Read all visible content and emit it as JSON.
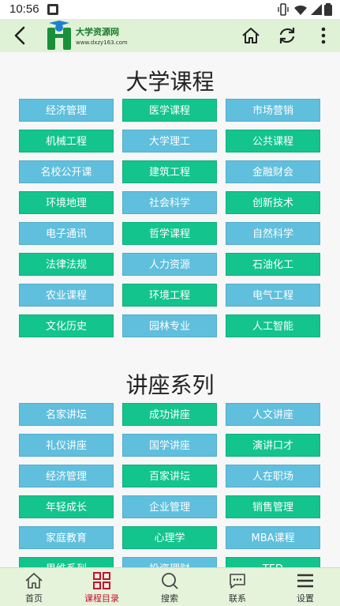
{
  "status_bar": {
    "time": "10:56"
  },
  "app_bar": {
    "logo_name": "大学资源网",
    "logo_url": "www.dxzy163.com"
  },
  "colors": {
    "blue": "#5fbfdd",
    "green": "#13c48d",
    "header_bg": "#dff2d6",
    "active_tab": "#c8102e"
  },
  "sections": [
    {
      "title": "大学课程",
      "items": [
        {
          "label": "经济管理",
          "color": "blue"
        },
        {
          "label": "医学课程",
          "color": "green"
        },
        {
          "label": "市场营销",
          "color": "blue"
        },
        {
          "label": "机械工程",
          "color": "green"
        },
        {
          "label": "大学理工",
          "color": "blue"
        },
        {
          "label": "公共课程",
          "color": "green"
        },
        {
          "label": "名校公开课",
          "color": "blue"
        },
        {
          "label": "建筑工程",
          "color": "green"
        },
        {
          "label": "金融财会",
          "color": "blue"
        },
        {
          "label": "环境地理",
          "color": "green"
        },
        {
          "label": "社会科学",
          "color": "blue"
        },
        {
          "label": "创新技术",
          "color": "green"
        },
        {
          "label": "电子通讯",
          "color": "blue"
        },
        {
          "label": "哲学课程",
          "color": "green"
        },
        {
          "label": "自然科学",
          "color": "blue"
        },
        {
          "label": "法律法规",
          "color": "green"
        },
        {
          "label": "人力资源",
          "color": "blue"
        },
        {
          "label": "石油化工",
          "color": "green"
        },
        {
          "label": "农业课程",
          "color": "blue"
        },
        {
          "label": "环境工程",
          "color": "green"
        },
        {
          "label": "电气工程",
          "color": "blue"
        },
        {
          "label": "文化历史",
          "color": "green"
        },
        {
          "label": "园林专业",
          "color": "blue"
        },
        {
          "label": "人工智能",
          "color": "green"
        }
      ]
    },
    {
      "title": "讲座系列",
      "items": [
        {
          "label": "名家讲坛",
          "color": "blue"
        },
        {
          "label": "成功讲座",
          "color": "green"
        },
        {
          "label": "人文讲座",
          "color": "blue"
        },
        {
          "label": "礼仪讲座",
          "color": "blue"
        },
        {
          "label": "国学讲座",
          "color": "blue"
        },
        {
          "label": "演讲口才",
          "color": "green"
        },
        {
          "label": "经济管理",
          "color": "blue"
        },
        {
          "label": "百家讲坛",
          "color": "green"
        },
        {
          "label": "人在职场",
          "color": "blue"
        },
        {
          "label": "年轻成长",
          "color": "green"
        },
        {
          "label": "企业管理",
          "color": "blue"
        },
        {
          "label": "销售管理",
          "color": "green"
        },
        {
          "label": "家庭教育",
          "color": "blue"
        },
        {
          "label": "心理学",
          "color": "green"
        },
        {
          "label": "MBA课程",
          "color": "blue"
        },
        {
          "label": "思维系列",
          "color": "green"
        },
        {
          "label": "投资理财",
          "color": "blue"
        },
        {
          "label": "TED",
          "color": "green"
        }
      ]
    }
  ],
  "tabs": [
    {
      "label": "首页",
      "icon": "home-icon",
      "active": false
    },
    {
      "label": "课程目录",
      "icon": "grid-icon",
      "active": true
    },
    {
      "label": "搜索",
      "icon": "search-icon",
      "active": false
    },
    {
      "label": "联系",
      "icon": "chat-icon",
      "active": false
    },
    {
      "label": "设置",
      "icon": "menu-icon",
      "active": false
    }
  ]
}
